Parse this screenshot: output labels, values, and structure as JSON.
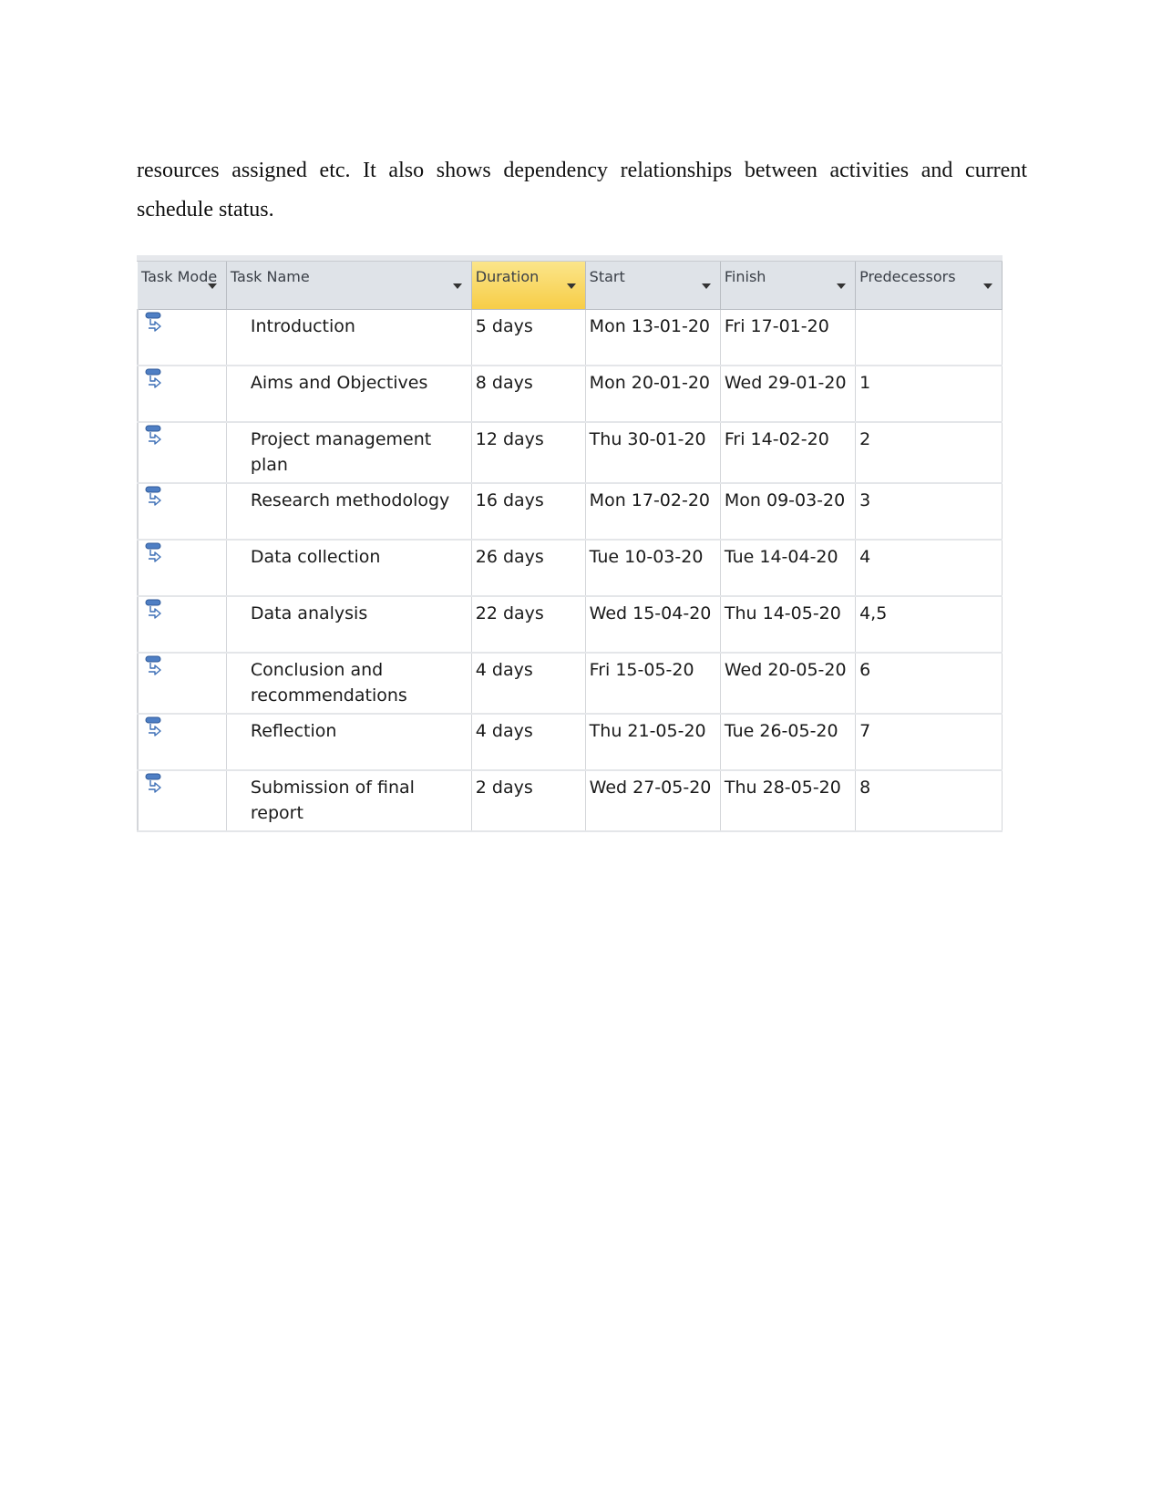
{
  "paragraph": "resources assigned etc. It also shows dependency relationships between activities and current schedule status.",
  "table": {
    "headers": {
      "task_mode": "Task Mode",
      "task_name": "Task Name",
      "duration": "Duration",
      "start": "Start",
      "finish": "Finish",
      "predecessors": "Predecessors"
    },
    "task_mode_icon": "auto-scheduled-task-icon",
    "rows": [
      {
        "name": "Introduction",
        "duration": "5 days",
        "start": "Mon 13-01-20",
        "finish": "Fri 17-01-20",
        "predecessors": ""
      },
      {
        "name": "Aims and Objectives",
        "duration": "8 days",
        "start": "Mon 20-01-20",
        "finish": "Wed 29-01-20",
        "predecessors": "1"
      },
      {
        "name": "Project management plan",
        "duration": "12 days",
        "start": "Thu 30-01-20",
        "finish": "Fri 14-02-20",
        "predecessors": "2"
      },
      {
        "name": "Research methodology",
        "duration": "16 days",
        "start": "Mon 17-02-20",
        "finish": "Mon 09-03-20",
        "predecessors": "3"
      },
      {
        "name": "Data collection",
        "duration": "26 days",
        "start": "Tue 10-03-20",
        "finish": "Tue 14-04-20",
        "predecessors": "4"
      },
      {
        "name": "Data analysis",
        "duration": "22 days",
        "start": "Wed 15-04-20",
        "finish": "Thu 14-05-20",
        "predecessors": "4,5"
      },
      {
        "name": "Conclusion and recommendations",
        "duration": "4 days",
        "start": "Fri 15-05-20",
        "finish": "Wed 20-05-20",
        "predecessors": "6"
      },
      {
        "name": "Reflection",
        "duration": "4 days",
        "start": "Thu 21-05-20",
        "finish": "Tue 26-05-20",
        "predecessors": "7"
      },
      {
        "name": "Submission of final report",
        "duration": "2 days",
        "start": "Wed 27-05-20",
        "finish": "Thu 28-05-20",
        "predecessors": "8"
      }
    ]
  }
}
